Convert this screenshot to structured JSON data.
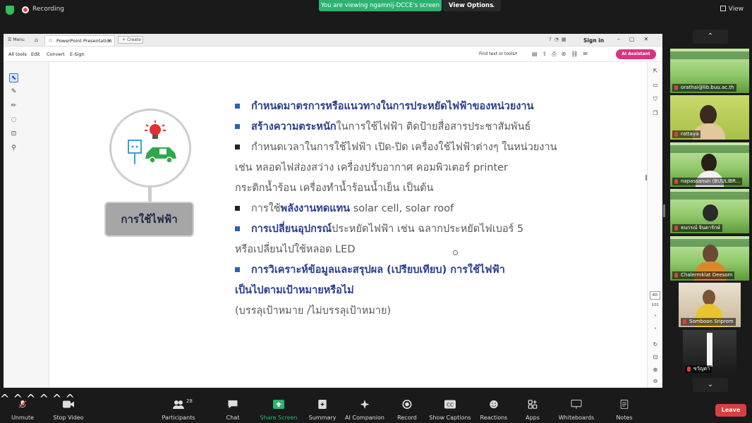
{
  "zoom_top": {
    "recording": "Recording",
    "viewing_banner": "You are viewing ngamnij-DCCE's screen",
    "view_options": "View Options",
    "view": "View"
  },
  "app": {
    "menu": "Menu",
    "tab_title": "PowerPoint Presentation",
    "create": "Create",
    "sign_in": "Sign in",
    "menus": [
      "All tools",
      "Edit",
      "Convert",
      "E-Sign"
    ],
    "find": "Find text or tools",
    "ai_assistant": "AI Assistant",
    "page_number": "60",
    "page_total": "101"
  },
  "slide": {
    "pill_label": "การใช้ไฟฟ้า",
    "bullets": [
      {
        "line1": "กำหนดมาตรการหรือแนวทางในการประหยัดไฟฟ้าของหน่วยงาน"
      },
      {
        "bold": "สร้างความตระหนัก",
        "rest": "ในการใช้ไฟฟ้า  ติดป้ายสื่อสารประชาสัมพันธ์"
      },
      {
        "line1": "กำหนดเวลาในการใช้ไฟฟ้า เปิด-ปิด เครื่องใช้ไฟฟ้าต่างๆ ในหน่วยงาน",
        "line2": "เช่น หลอดไฟส่องสว่าง เครื่องปรับอากาศ คอมพิวเตอร์ printer",
        "line3": "กระติกน้ำร้อน  เครื่องทำน้ำร้อนน้ำเย็น เป็นต้น"
      },
      {
        "pre": "การใช้",
        "bold": "พลังงานทดแทน",
        "rest": " solar cell, solar roof"
      },
      {
        "bold": "การเปลี่ยนอุปกรณ์",
        "rest": "ประหยัดไฟฟ้า เช่น ฉลากประหยัดไฟเบอร์ 5",
        "line2": "หรือเปลี่ยนไปใช้หลอด LED"
      },
      {
        "line1": "การวิเคราะห์ข้อมูลและสรุปผล (เปรียบเทียบ) การใช้ไฟฟ้า",
        "line2": " เป็นไปตามเป้าหมายหรือไม่",
        "line3": "(บรรลุเป้าหมาย /ไม่บรรลุเป้าหมาย)"
      }
    ],
    "colors": {
      "navy": "#2a3f8f",
      "bullet_blue": "#2f5fb5",
      "gray": "#595959",
      "green": "#2ea84a",
      "red": "#e03030"
    }
  },
  "participants_panel": [
    "orathai@lib.buu.ac.th",
    "rattaya",
    "napassanun (BUULIBR...",
    "ธนกรณ์ จินดารักษ์",
    "Chalermklat Deesom",
    "Somboon Sriprom",
    "ขวัญตา"
  ],
  "toolbar": {
    "unmute": "Unmute",
    "stop_video": "Stop Video",
    "participants": "Participants",
    "participants_count": "28",
    "chat": "Chat",
    "share_screen": "Share Screen",
    "summary": "Summary",
    "ai_companion": "AI Companion",
    "record": "Record",
    "show_captions": "Show Captions",
    "reactions": "Reactions",
    "apps": "Apps",
    "whiteboards": "Whiteboards",
    "notes": "Notes",
    "leave": "Leave"
  }
}
